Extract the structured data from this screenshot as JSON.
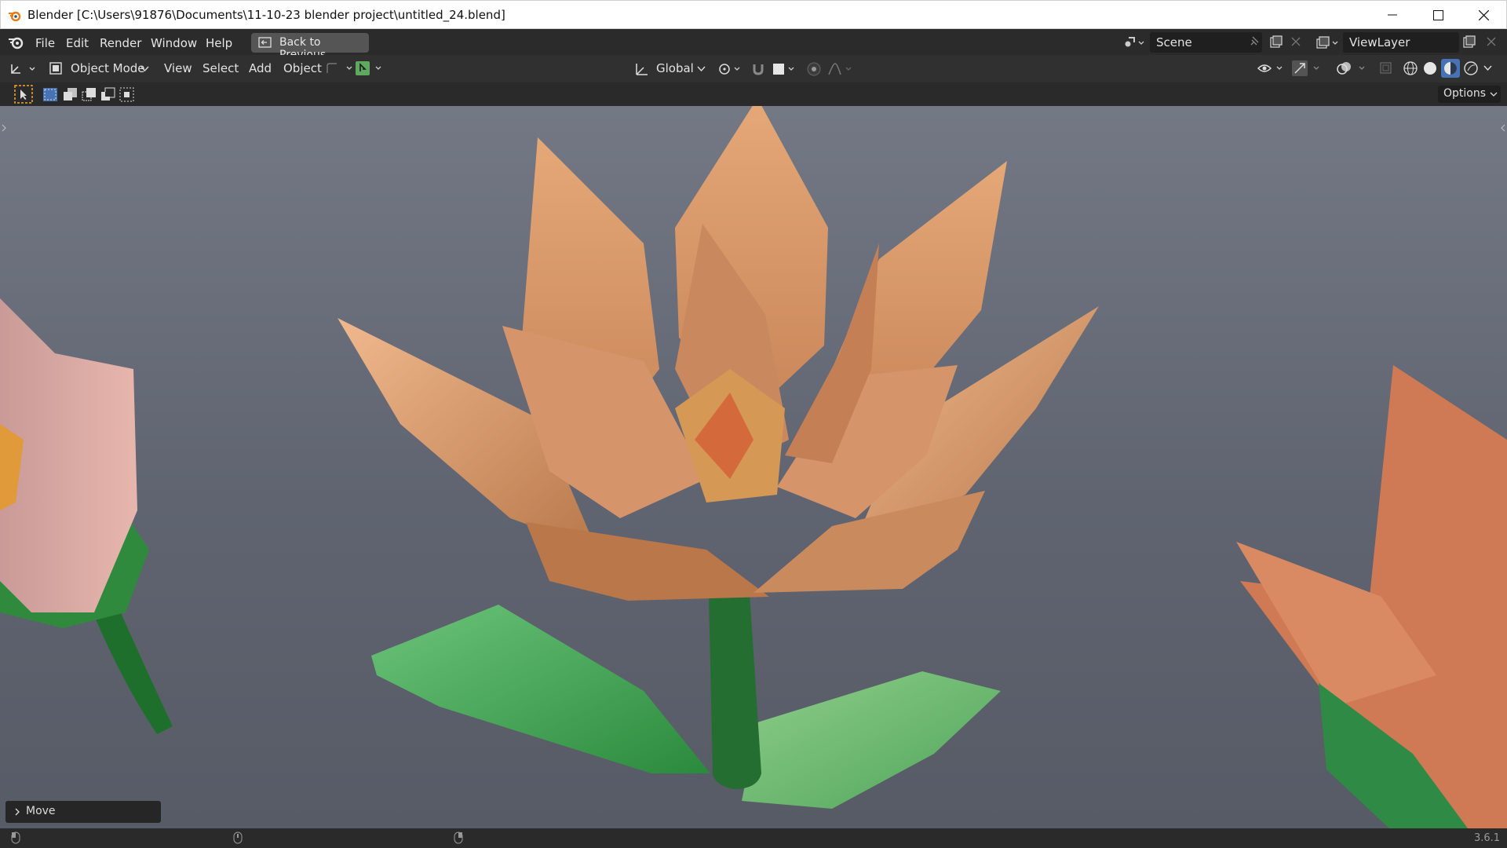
{
  "window": {
    "title": "Blender [C:\\Users\\91876\\Documents\\11-10-23 blender project\\untitled_24.blend]"
  },
  "menubar": {
    "items": [
      "File",
      "Edit",
      "Render",
      "Window",
      "Help"
    ],
    "back_button": "Back to Previous",
    "scene_name": "Scene",
    "view_layer_name": "ViewLayer"
  },
  "header": {
    "mode": "Object Mode",
    "menus": [
      "View",
      "Select",
      "Add",
      "Object"
    ],
    "transform_orientation": "Global"
  },
  "toolbar": {
    "options_label": "Options"
  },
  "viewport": {
    "operator_panel_label": "Move",
    "scene_subject": "low-poly flowers"
  },
  "statusbar": {
    "version": "3.6.1"
  },
  "colors": {
    "accent_blue": "#4772b3",
    "select_orange": "#f1a832",
    "active_green": "#5fa85f"
  }
}
